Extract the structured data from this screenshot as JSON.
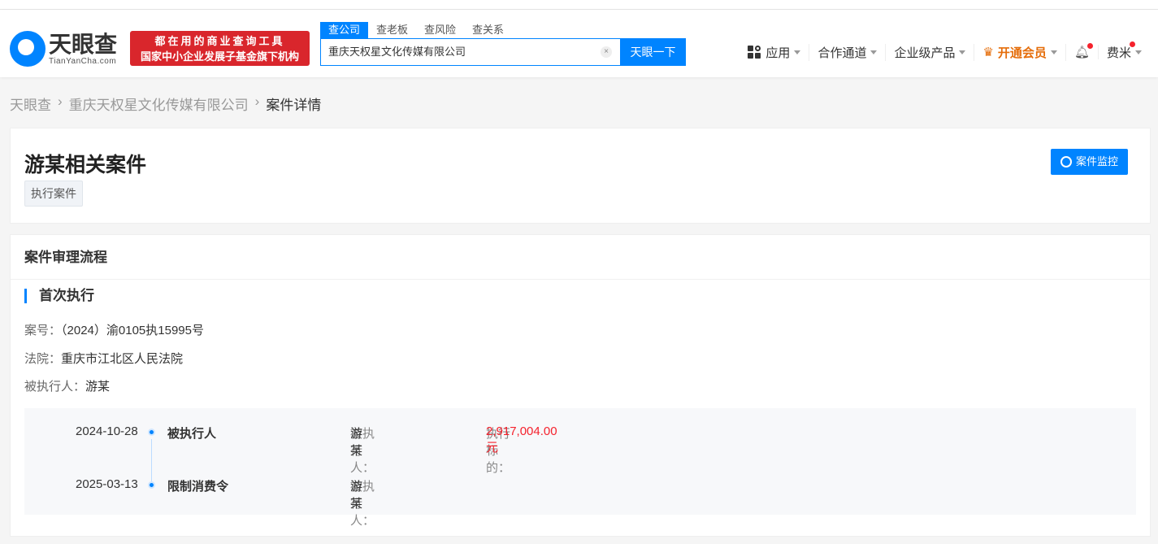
{
  "header": {
    "logo_cn": "天眼查",
    "logo_en": "TianYanCha.com",
    "slogan1": "都在用的商业查询工具",
    "slogan2": "国家中小企业发展子基金旗下机构",
    "tabs": [
      "查公司",
      "查老板",
      "查风险",
      "查关系"
    ],
    "search_value": "重庆天权星文化传媒有限公司",
    "clear": "×",
    "search_button": "天眼一下",
    "nav": {
      "apps": "应用",
      "channel": "合作通道",
      "enterprise": "企业级产品",
      "vip": "开通会员",
      "user": "费米"
    }
  },
  "breadcrumb": [
    "天眼查",
    "重庆天权星文化传媒有限公司",
    "案件详情"
  ],
  "case": {
    "title": "游某相关案件",
    "tag": "执行案件",
    "monitor": "案件监控"
  },
  "process": {
    "title": "案件审理流程",
    "stage": "首次执行",
    "info": [
      {
        "k": "案号：",
        "v": "（2024）渝0105执15995号"
      },
      {
        "k": "法院：",
        "v": "重庆市江北区人民法院"
      },
      {
        "k": "被执行人：",
        "v": "游某"
      }
    ],
    "events": [
      {
        "date": "2024-10-28",
        "name": "被执行人",
        "party_label": "被执行人：",
        "party": "游某",
        "amount_label": "执行标的：",
        "amount": "2,917,004.00元"
      },
      {
        "date": "2025-03-13",
        "name": "限制消费令",
        "party_label": "被执行人：",
        "party": "游某"
      }
    ]
  },
  "colors": {
    "accent": "#0084ff",
    "vip": "#e56d0a",
    "red": "#f5222d"
  }
}
